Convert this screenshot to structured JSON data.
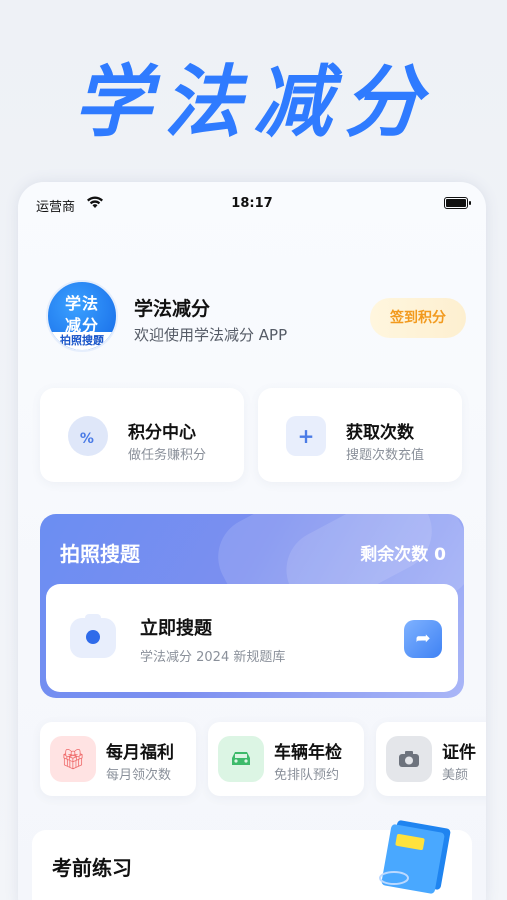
{
  "hero": {
    "title": "学法减分"
  },
  "status_bar": {
    "carrier": "运营商",
    "time": "18:17"
  },
  "profile": {
    "avatar_line1": "学法",
    "avatar_line2": "减分",
    "avatar_strip": "拍照搜题",
    "app_name": "学法减分",
    "welcome": "欢迎使用学法减分 APP",
    "checkin_label": "签到积分"
  },
  "quick_cards": [
    {
      "title": "积分中心",
      "subtitle": "做任务赚积分",
      "icon": "percent-badge-icon",
      "glyph": "%"
    },
    {
      "title": "获取次数",
      "subtitle": "搜题次数充值",
      "icon": "plus-icon",
      "glyph": "+"
    }
  ],
  "search_panel": {
    "title": "拍照搜题",
    "remaining": "剩余次数 0",
    "action_title": "立即搜题",
    "action_subtitle": "学法减分 2024 新规题库"
  },
  "services": [
    {
      "title": "每月福利",
      "subtitle": "每月领次数",
      "icon": "gift-icon",
      "color": "#ffe3e3",
      "icon_color": "#ef6a6a"
    },
    {
      "title": "车辆年检",
      "subtitle": "免排队预约",
      "icon": "car-icon",
      "color": "#dcf5e4",
      "icon_color": "#3dba6a"
    },
    {
      "title": "证件",
      "subtitle": "美颜",
      "icon": "camera-icon",
      "color": "#e4e6ea",
      "icon_color": "#6d737d"
    }
  ],
  "practice": {
    "title": "考前练习"
  },
  "colors": {
    "accent": "#2f7bff",
    "panel": "#6b8ef2",
    "checkin": "#f29a1e"
  }
}
